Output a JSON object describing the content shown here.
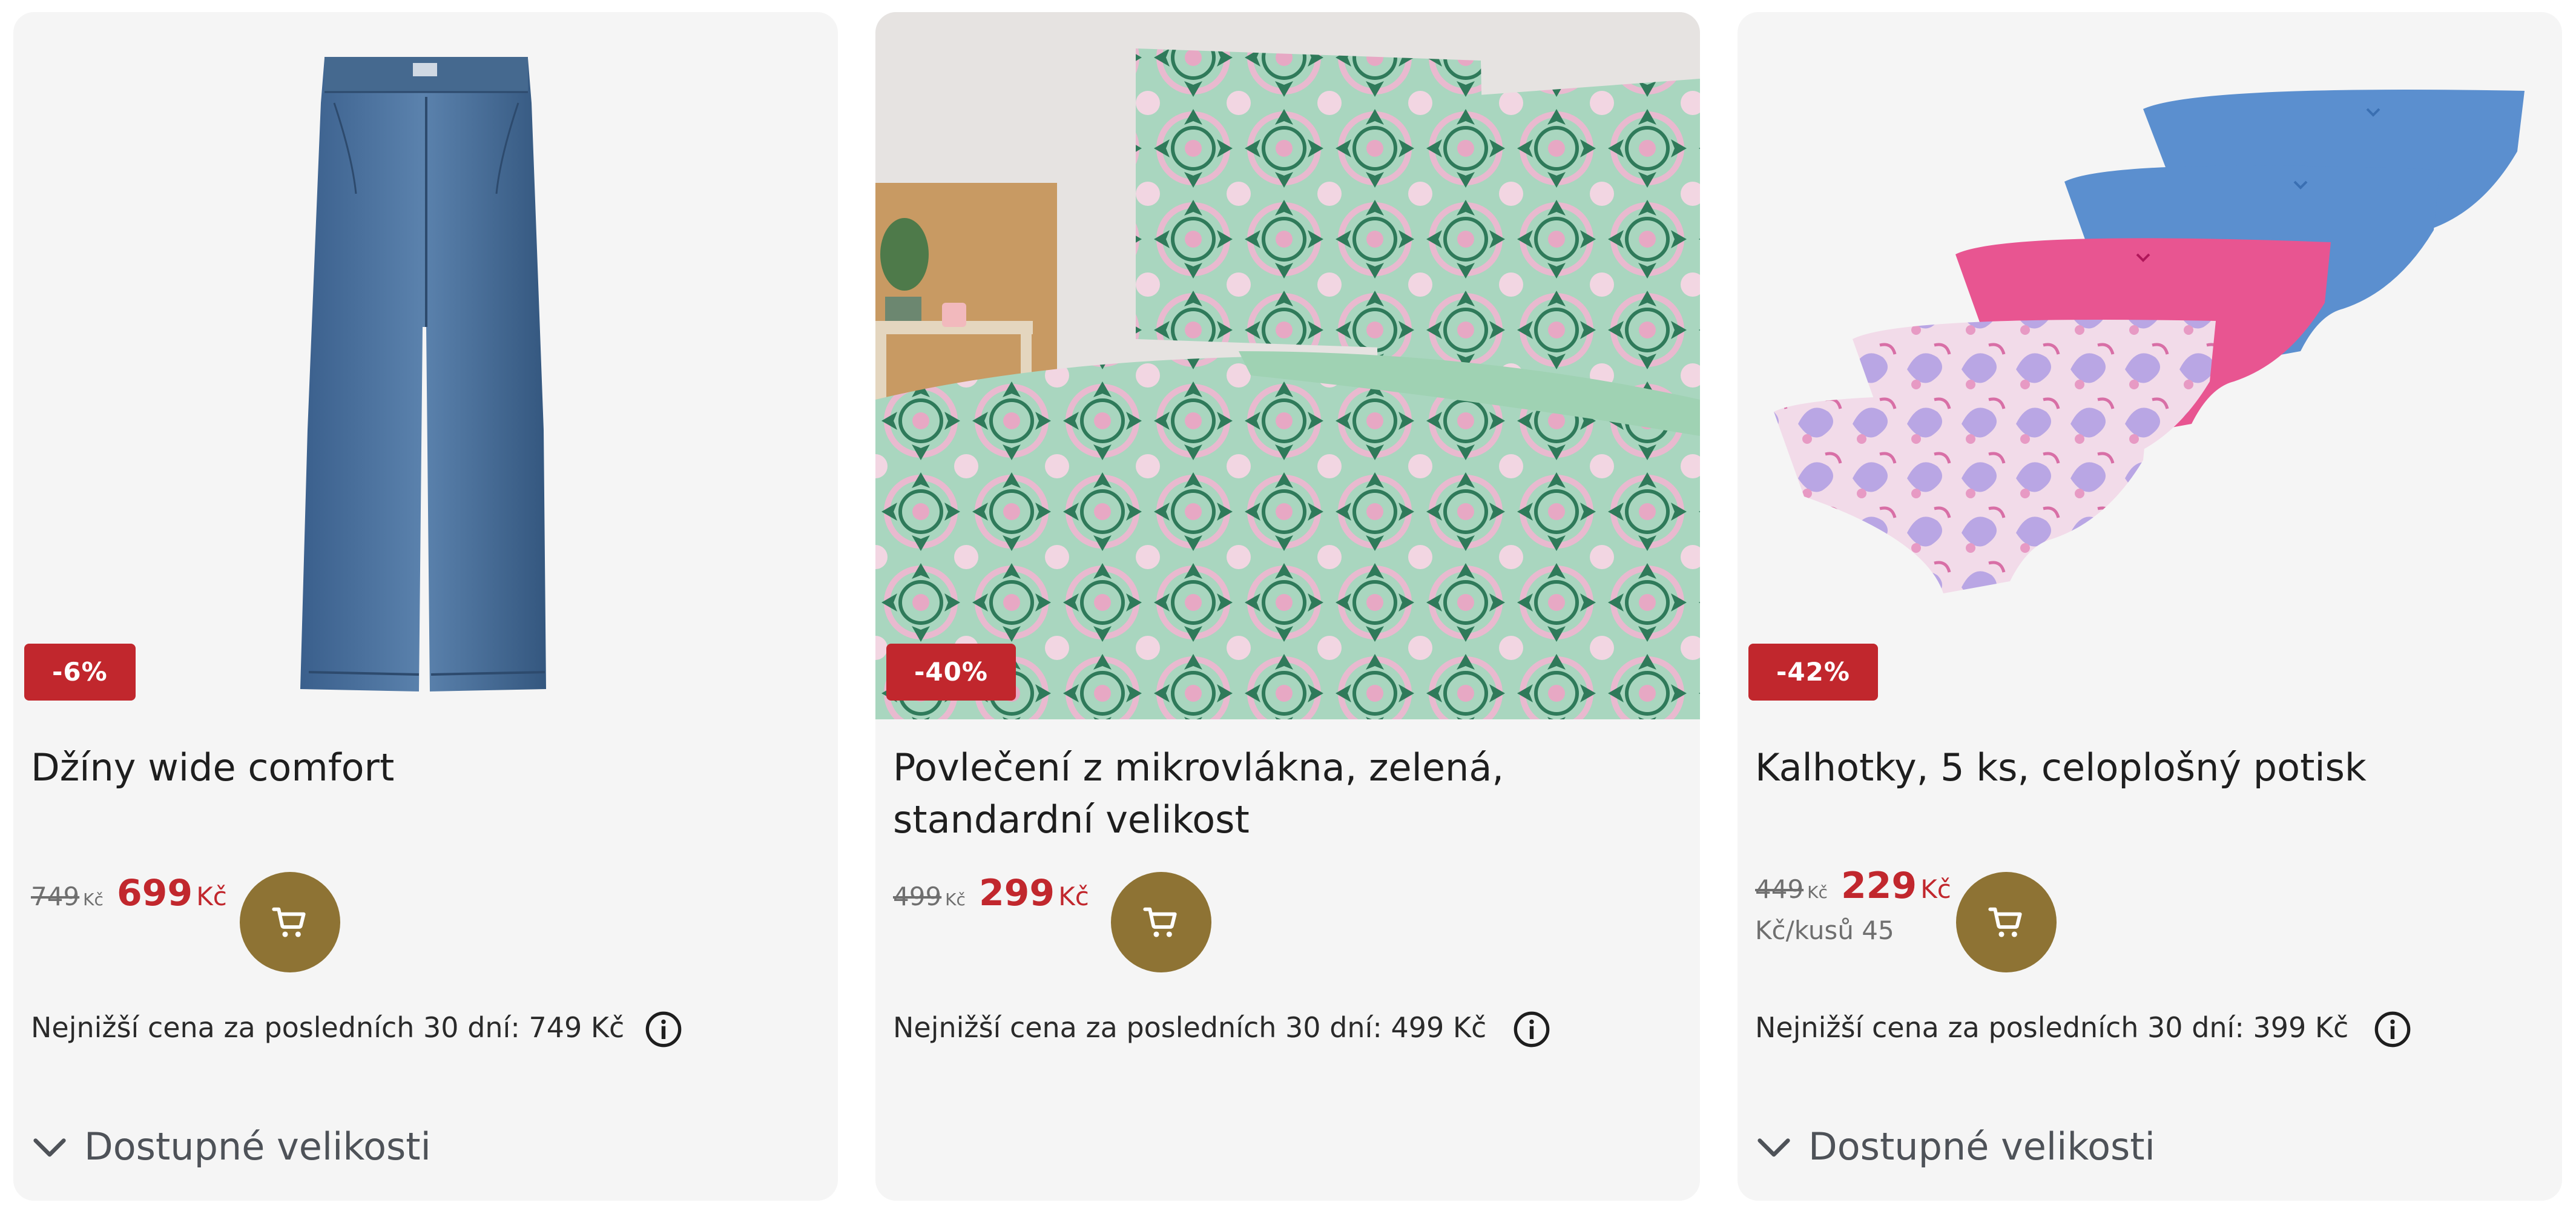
{
  "colors": {
    "card_background": "#f5f5f5",
    "badge": "#c1272d",
    "sale_price": "#c1272d",
    "cart_button": "#8e7334",
    "muted_text": "#6f6f6f"
  },
  "products": [
    {
      "image_icon": "jeans-image",
      "discount": "-6%",
      "title": "Džíny wide comfort",
      "old_price": "749",
      "old_currency": "Kč",
      "new_price": "699",
      "new_currency": "Kč",
      "unit_price": "",
      "lowest_price_text": "Nejnižší cena za posledních 30 dní: 749 Kč",
      "sizes_label": "Dostupné velikosti"
    },
    {
      "image_icon": "bedding-image",
      "discount": "-40%",
      "title": "Povlečení z mikrovlákna, zelená, standardní velikost",
      "old_price": "499",
      "old_currency": "Kč",
      "new_price": "299",
      "new_currency": "Kč",
      "unit_price": "",
      "lowest_price_text": "Nejnižší cena za posledních 30 dní: 499 Kč",
      "sizes_label": ""
    },
    {
      "image_icon": "underwear-set-image",
      "discount": "-42%",
      "title": "Kalhotky, 5 ks, celoplošný potisk",
      "old_price": "449",
      "old_currency": "Kč",
      "new_price": "229",
      "new_currency": "Kč",
      "unit_price": "Kč/kusů 45",
      "lowest_price_text": "Nejnižší cena za posledních 30 dní: 399 Kč",
      "sizes_label": "Dostupné velikosti"
    }
  ]
}
